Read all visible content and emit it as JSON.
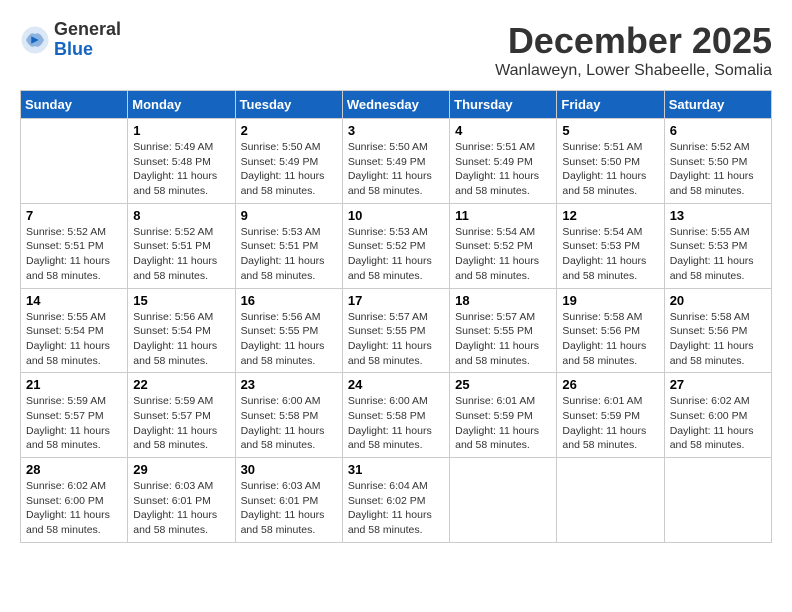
{
  "header": {
    "logo_line1": "General",
    "logo_line2": "Blue",
    "title": "December 2025",
    "subtitle": "Wanlaweyn, Lower Shabeelle, Somalia"
  },
  "calendar": {
    "days_of_week": [
      "Sunday",
      "Monday",
      "Tuesday",
      "Wednesday",
      "Thursday",
      "Friday",
      "Saturday"
    ],
    "weeks": [
      [
        {
          "day": "",
          "info": ""
        },
        {
          "day": "1",
          "info": "Sunrise: 5:49 AM\nSunset: 5:48 PM\nDaylight: 11 hours\nand 58 minutes."
        },
        {
          "day": "2",
          "info": "Sunrise: 5:50 AM\nSunset: 5:49 PM\nDaylight: 11 hours\nand 58 minutes."
        },
        {
          "day": "3",
          "info": "Sunrise: 5:50 AM\nSunset: 5:49 PM\nDaylight: 11 hours\nand 58 minutes."
        },
        {
          "day": "4",
          "info": "Sunrise: 5:51 AM\nSunset: 5:49 PM\nDaylight: 11 hours\nand 58 minutes."
        },
        {
          "day": "5",
          "info": "Sunrise: 5:51 AM\nSunset: 5:50 PM\nDaylight: 11 hours\nand 58 minutes."
        },
        {
          "day": "6",
          "info": "Sunrise: 5:52 AM\nSunset: 5:50 PM\nDaylight: 11 hours\nand 58 minutes."
        }
      ],
      [
        {
          "day": "7",
          "info": "Sunrise: 5:52 AM\nSunset: 5:51 PM\nDaylight: 11 hours\nand 58 minutes."
        },
        {
          "day": "8",
          "info": "Sunrise: 5:52 AM\nSunset: 5:51 PM\nDaylight: 11 hours\nand 58 minutes."
        },
        {
          "day": "9",
          "info": "Sunrise: 5:53 AM\nSunset: 5:51 PM\nDaylight: 11 hours\nand 58 minutes."
        },
        {
          "day": "10",
          "info": "Sunrise: 5:53 AM\nSunset: 5:52 PM\nDaylight: 11 hours\nand 58 minutes."
        },
        {
          "day": "11",
          "info": "Sunrise: 5:54 AM\nSunset: 5:52 PM\nDaylight: 11 hours\nand 58 minutes."
        },
        {
          "day": "12",
          "info": "Sunrise: 5:54 AM\nSunset: 5:53 PM\nDaylight: 11 hours\nand 58 minutes."
        },
        {
          "day": "13",
          "info": "Sunrise: 5:55 AM\nSunset: 5:53 PM\nDaylight: 11 hours\nand 58 minutes."
        }
      ],
      [
        {
          "day": "14",
          "info": "Sunrise: 5:55 AM\nSunset: 5:54 PM\nDaylight: 11 hours\nand 58 minutes."
        },
        {
          "day": "15",
          "info": "Sunrise: 5:56 AM\nSunset: 5:54 PM\nDaylight: 11 hours\nand 58 minutes."
        },
        {
          "day": "16",
          "info": "Sunrise: 5:56 AM\nSunset: 5:55 PM\nDaylight: 11 hours\nand 58 minutes."
        },
        {
          "day": "17",
          "info": "Sunrise: 5:57 AM\nSunset: 5:55 PM\nDaylight: 11 hours\nand 58 minutes."
        },
        {
          "day": "18",
          "info": "Sunrise: 5:57 AM\nSunset: 5:55 PM\nDaylight: 11 hours\nand 58 minutes."
        },
        {
          "day": "19",
          "info": "Sunrise: 5:58 AM\nSunset: 5:56 PM\nDaylight: 11 hours\nand 58 minutes."
        },
        {
          "day": "20",
          "info": "Sunrise: 5:58 AM\nSunset: 5:56 PM\nDaylight: 11 hours\nand 58 minutes."
        }
      ],
      [
        {
          "day": "21",
          "info": "Sunrise: 5:59 AM\nSunset: 5:57 PM\nDaylight: 11 hours\nand 58 minutes."
        },
        {
          "day": "22",
          "info": "Sunrise: 5:59 AM\nSunset: 5:57 PM\nDaylight: 11 hours\nand 58 minutes."
        },
        {
          "day": "23",
          "info": "Sunrise: 6:00 AM\nSunset: 5:58 PM\nDaylight: 11 hours\nand 58 minutes."
        },
        {
          "day": "24",
          "info": "Sunrise: 6:00 AM\nSunset: 5:58 PM\nDaylight: 11 hours\nand 58 minutes."
        },
        {
          "day": "25",
          "info": "Sunrise: 6:01 AM\nSunset: 5:59 PM\nDaylight: 11 hours\nand 58 minutes."
        },
        {
          "day": "26",
          "info": "Sunrise: 6:01 AM\nSunset: 5:59 PM\nDaylight: 11 hours\nand 58 minutes."
        },
        {
          "day": "27",
          "info": "Sunrise: 6:02 AM\nSunset: 6:00 PM\nDaylight: 11 hours\nand 58 minutes."
        }
      ],
      [
        {
          "day": "28",
          "info": "Sunrise: 6:02 AM\nSunset: 6:00 PM\nDaylight: 11 hours\nand 58 minutes."
        },
        {
          "day": "29",
          "info": "Sunrise: 6:03 AM\nSunset: 6:01 PM\nDaylight: 11 hours\nand 58 minutes."
        },
        {
          "day": "30",
          "info": "Sunrise: 6:03 AM\nSunset: 6:01 PM\nDaylight: 11 hours\nand 58 minutes."
        },
        {
          "day": "31",
          "info": "Sunrise: 6:04 AM\nSunset: 6:02 PM\nDaylight: 11 hours\nand 58 minutes."
        },
        {
          "day": "",
          "info": ""
        },
        {
          "day": "",
          "info": ""
        },
        {
          "day": "",
          "info": ""
        }
      ]
    ]
  }
}
